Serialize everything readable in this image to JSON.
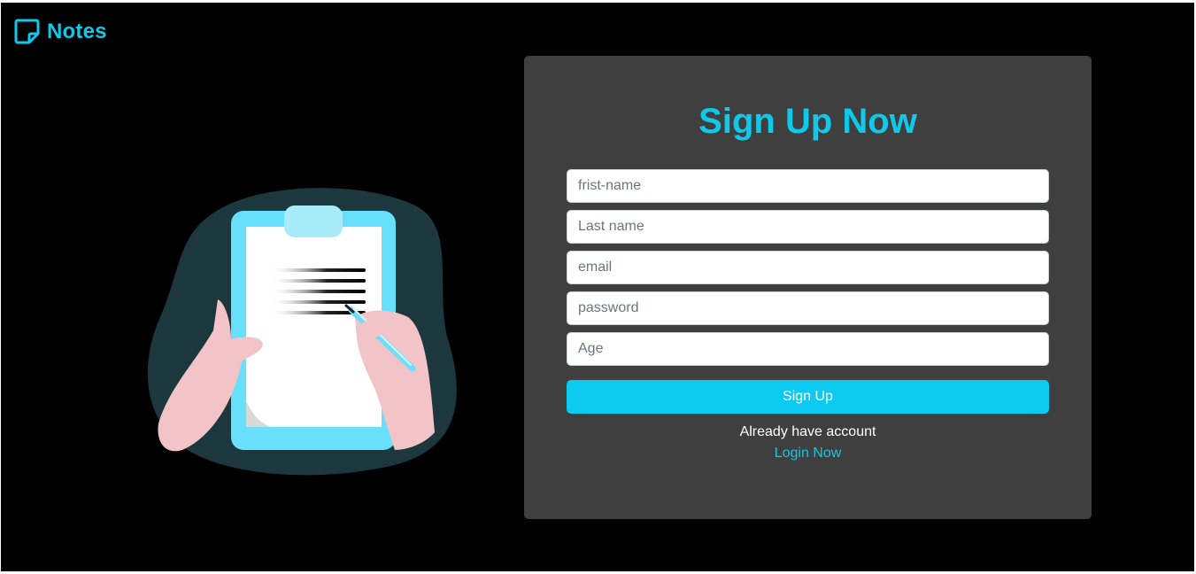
{
  "brand": {
    "name": "Notes",
    "icon": "sticky-note-icon",
    "color": "#10c8ea"
  },
  "illustration": {
    "subject": "clipboard-writing-illustration"
  },
  "signup": {
    "title": "Sign Up Now",
    "fields": {
      "first_name_placeholder": "frist-name",
      "last_name_placeholder": "Last name",
      "email_placeholder": "email",
      "password_placeholder": "password",
      "age_placeholder": "Age"
    },
    "submit_label": "Sign Up",
    "already_text": "Already have account",
    "login_link": "Login Now"
  },
  "colors": {
    "background": "#000000",
    "card": "#3f3f3f",
    "accent": "#10c8ea",
    "button": "#0dcaf0"
  }
}
